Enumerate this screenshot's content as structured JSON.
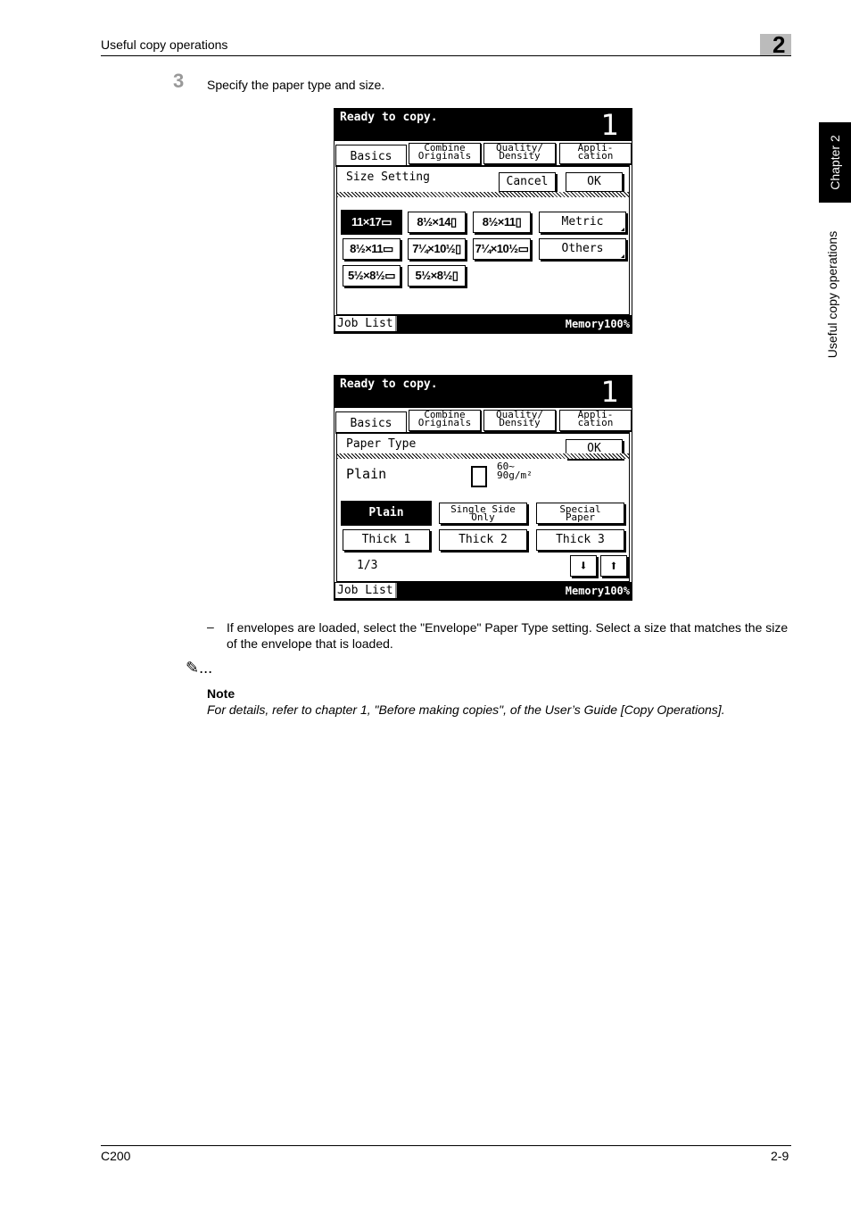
{
  "header": {
    "section_title": "Useful copy operations",
    "chapter_number": "2"
  },
  "side_tab": {
    "chapter_label": "Chapter 2",
    "section_label": "Useful copy operations"
  },
  "step": {
    "number": "3",
    "text": "Specify the paper type and size."
  },
  "screen1": {
    "status": "Ready to copy.",
    "copy_count": "1",
    "tabs": [
      {
        "l1": "Basics",
        "l2": ""
      },
      {
        "l1": "Combine",
        "l2": "Originals"
      },
      {
        "l1": "Quality/",
        "l2": "Density"
      },
      {
        "l1": "Appli-",
        "l2": "cation"
      }
    ],
    "panel_title": "Size Setting",
    "cancel_label": "Cancel",
    "ok_label": "OK",
    "sizes": [
      "11×17▭",
      "8½×14▯",
      "8½×11▯",
      "8½×11▭",
      "7¼×10½▯",
      "7¼×10½▭",
      "5½×8½▭",
      "5½×8½▯"
    ],
    "metric_label": "Metric",
    "others_label": "Others",
    "job_list_label": "Job List",
    "memory": "Memory100%"
  },
  "screen2": {
    "status": "Ready to copy.",
    "copy_count": "1",
    "tabs": [
      {
        "l1": "Basics",
        "l2": ""
      },
      {
        "l1": "Combine",
        "l2": "Originals"
      },
      {
        "l1": "Quality/",
        "l2": "Density"
      },
      {
        "l1": "Appli-",
        "l2": "cation"
      }
    ],
    "panel_title": "Paper Type",
    "ok_label": "OK",
    "current_type": "Plain",
    "weight_l1": "60~",
    "weight_l2": "90g/m²",
    "types": [
      {
        "l1": "Plain",
        "l2": ""
      },
      {
        "l1": "Single Side",
        "l2": "Only"
      },
      {
        "l1": "Special",
        "l2": "Paper"
      },
      {
        "l1": "Thick 1",
        "l2": ""
      },
      {
        "l1": "Thick 2",
        "l2": ""
      },
      {
        "l1": "Thick 3",
        "l2": ""
      }
    ],
    "page_indicator": "1/3",
    "down_arrow": "⬇",
    "up_arrow": "⬆",
    "job_list_label": "Job List",
    "memory": "Memory100%"
  },
  "bullet": {
    "dash": "–",
    "text": "If envelopes are loaded, select the \"Envelope\" Paper Type setting. Select a size that matches the size of the envelope that is loaded."
  },
  "note": {
    "icon": "✎...",
    "label": "Note",
    "text": "For details, refer to chapter 1, \"Before making copies\", of the User’s Guide [Copy Operations]."
  },
  "footer": {
    "model": "C200",
    "page": "2-9"
  }
}
